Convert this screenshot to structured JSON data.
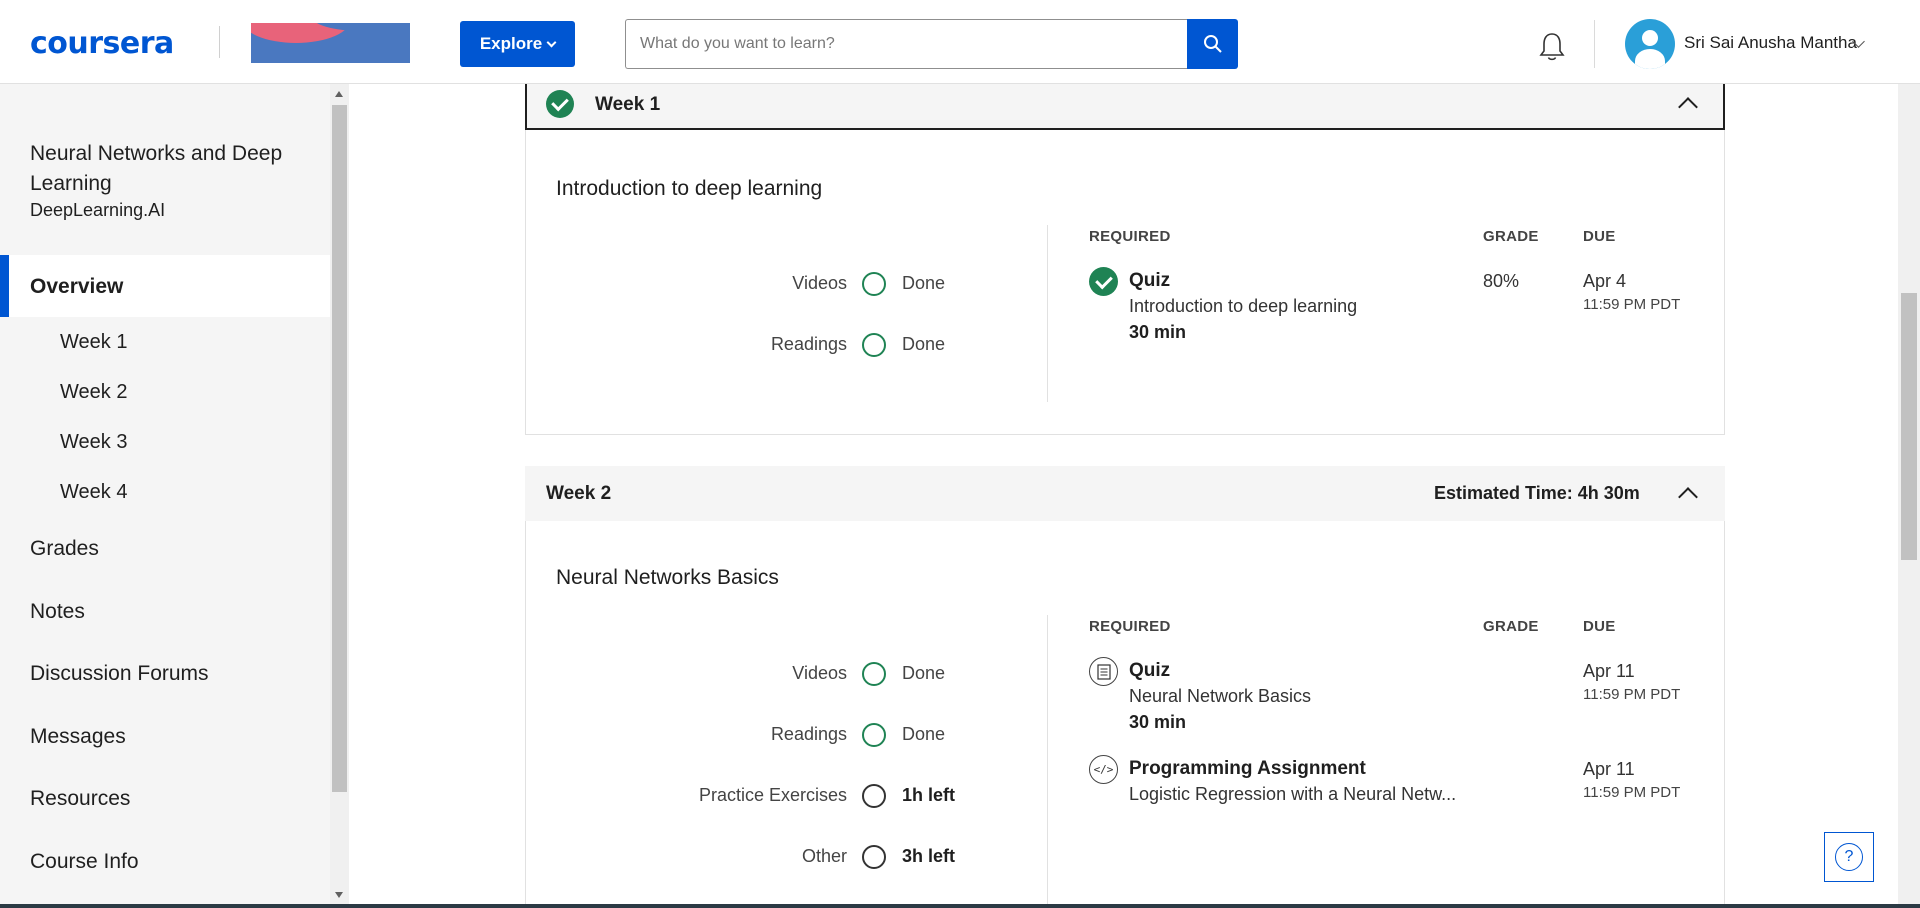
{
  "header": {
    "logo_text": "coursera",
    "explore_label": "Explore",
    "search_placeholder": "What do you want to learn?",
    "user_name": "Sri Sai Anusha Mantha"
  },
  "sidebar": {
    "course_title": "Neural Networks and Deep Learning",
    "course_org": "DeepLearning.AI",
    "overview_label": "Overview",
    "weeks": [
      "Week 1",
      "Week 2",
      "Week 3",
      "Week 4"
    ],
    "items": [
      "Grades",
      "Notes",
      "Discussion Forums",
      "Messages",
      "Resources",
      "Course Info"
    ]
  },
  "columns": {
    "required": "REQUIRED",
    "grade": "GRADE",
    "due": "DUE"
  },
  "week1": {
    "title": "Week 1",
    "completed": true,
    "section_title": "Introduction to deep learning",
    "progress": [
      {
        "label": "Videos",
        "status": "Done"
      },
      {
        "label": "Readings",
        "status": "Done"
      }
    ],
    "items": [
      {
        "type": "Quiz",
        "name": "Introduction to deep learning",
        "duration": "30 min",
        "grade": "80%",
        "due_date": "Apr 4",
        "due_time": "11:59 PM PDT",
        "icon": "check-circle-icon"
      }
    ]
  },
  "week2": {
    "title": "Week 2",
    "estimated_time": "Estimated Time: 4h 30m",
    "section_title": "Neural Networks Basics",
    "progress": [
      {
        "label": "Videos",
        "status": "Done"
      },
      {
        "label": "Readings",
        "status": "Done"
      },
      {
        "label": "Practice Exercises",
        "status": "1h left"
      },
      {
        "label": "Other",
        "status": "3h left"
      }
    ],
    "items": [
      {
        "type": "Quiz",
        "name": "Neural Network Basics",
        "duration": "30 min",
        "due_date": "Apr 11",
        "due_time": "11:59 PM PDT",
        "icon": "quiz-icon"
      },
      {
        "type": "Programming Assignment",
        "name": "Logistic Regression with a Neural Netw...",
        "due_date": "Apr 11",
        "due_time": "11:59 PM PDT",
        "icon": "code-icon"
      }
    ]
  },
  "help_label": "?",
  "colors": {
    "brand": "#0056d2",
    "success": "#1f8354",
    "sidebar_bg": "#f5f5f5"
  }
}
